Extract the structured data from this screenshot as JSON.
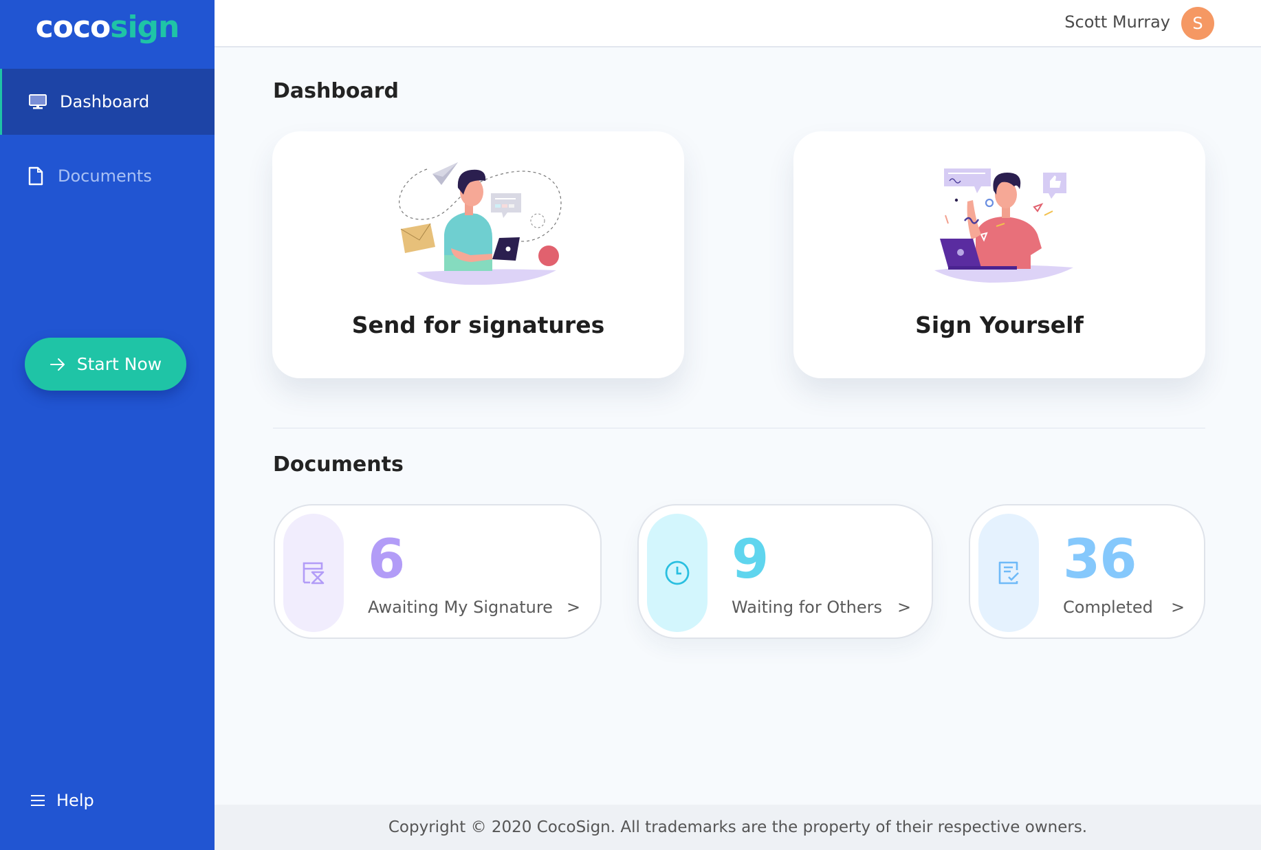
{
  "app": {
    "logo": {
      "part1": "coco",
      "part2": "sign"
    },
    "brand_colors": {
      "sidebar": "#2155d2",
      "accent": "#1fc4a6"
    }
  },
  "sidebar": {
    "items": [
      {
        "label": "Dashboard",
        "icon": "monitor-icon",
        "active": true
      },
      {
        "label": "Documents",
        "icon": "document-icon",
        "active": false
      }
    ],
    "start_button": {
      "label": "Start Now",
      "icon": "arrow-right-icon"
    },
    "help": {
      "label": "Help",
      "icon": "menu-icon"
    }
  },
  "header": {
    "user_name": "Scott Murray",
    "avatar_initial": "S",
    "avatar_color": "#f59863"
  },
  "main": {
    "dashboard_title": "Dashboard",
    "actions": [
      {
        "label": "Send for signatures",
        "illustration": "man-with-tablet-sending-illustration"
      },
      {
        "label": "Sign Yourself",
        "illustration": "man-with-laptop-signing-illustration"
      }
    ],
    "documents_title": "Documents",
    "stats": [
      {
        "count": "6",
        "label": "Awaiting My Signature",
        "chevron": ">",
        "icon": "hourglass-document-icon",
        "color": "#b29cf7",
        "pill_bg": "#f1edfd"
      },
      {
        "count": "9",
        "label": "Waiting for Others",
        "chevron": ">",
        "icon": "clock-icon",
        "color": "#5fd5ee",
        "pill_bg": "#d3f6fd"
      },
      {
        "count": "36",
        "label": "Completed",
        "chevron": ">",
        "icon": "checked-document-icon",
        "color": "#85c8fc",
        "pill_bg": "#e5f2fe"
      }
    ]
  },
  "footer": {
    "copyright": "Copyright © 2020 CocoSign. All trademarks are the property of their respective owners."
  }
}
